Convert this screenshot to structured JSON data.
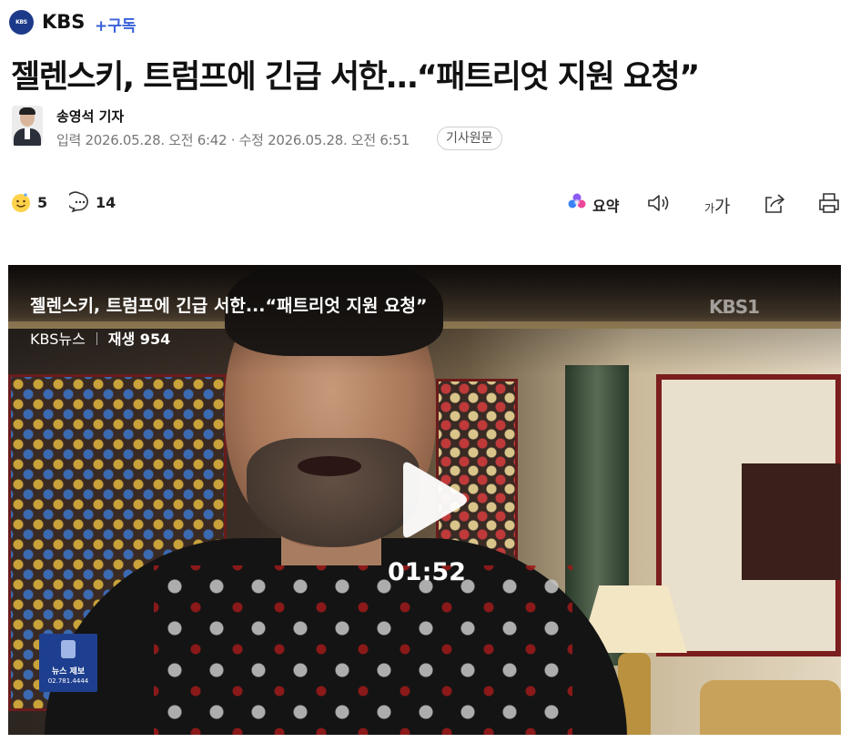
{
  "press": {
    "name": "KBS",
    "logo_text": "KBS NEWS",
    "subscribe_label": "+구독"
  },
  "article": {
    "title": "젤렌스키, 트럼프에 긴급 서한…“패트리엇 지원 요청”",
    "reporter": "송영석 기자",
    "dates": "입력 2026.05.28. 오전 6:42 · 수정 2026.05.28. 오전 6:51",
    "original_button": "기사원문"
  },
  "toolbar": {
    "reaction_count": "5",
    "comment_count": "14",
    "summary_label": "요약",
    "font_small": "가",
    "font_big": "가"
  },
  "video": {
    "title": "젤렌스키, 트럼프에 긴급 서한...“패트리엇 지원 요청”",
    "source": "KBS뉴스",
    "plays": "재생 954",
    "duration": "01:52",
    "watermark": "KBS1",
    "tip_label": "뉴스 제보",
    "tip_number": "02.781.4444"
  },
  "icons": {
    "logo": "kbs-logo-icon",
    "reaction": "smile-reaction-icon",
    "comment": "comment-icon",
    "summary": "ai-summary-icon",
    "audio": "speaker-icon",
    "font": "font-size-icon",
    "share": "share-icon",
    "print": "print-icon",
    "play": "play-icon"
  },
  "colors": {
    "accent": "#3860d8",
    "brand": "#1d3a8a",
    "text": "#111111",
    "muted": "#777777"
  }
}
